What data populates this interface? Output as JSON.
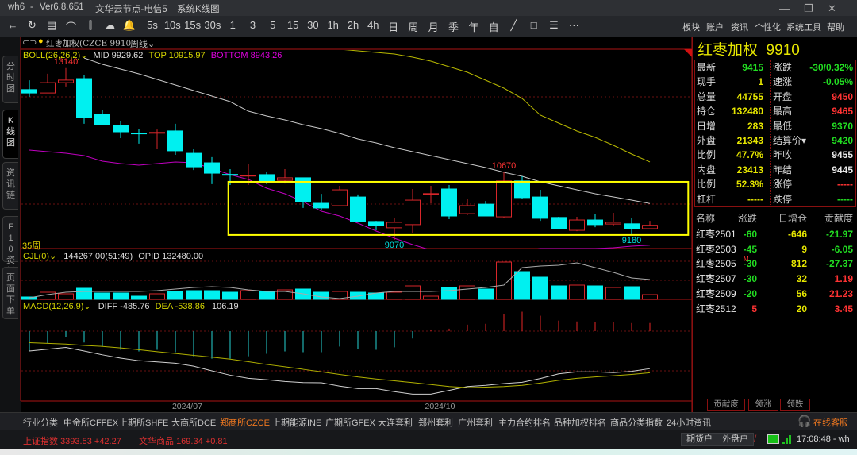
{
  "window": {
    "app": "wh6",
    "sep": "-",
    "version": "Ver6.8.651",
    "server": "文华云节点-电信5",
    "view": "系统K线图",
    "minimize": "—",
    "maximize": "❐",
    "close": "✕"
  },
  "toolbar": {
    "icons": [
      {
        "name": "back-arrow-icon",
        "glyph": "←"
      },
      {
        "name": "refresh-icon",
        "glyph": "↻"
      },
      {
        "name": "list-view-icon",
        "glyph": "▤"
      },
      {
        "name": "line-chart-icon",
        "glyph": "⌒"
      },
      {
        "name": "candlestick-icon",
        "glyph": "⫿"
      },
      {
        "name": "cloud-sync-icon",
        "glyph": "☁"
      },
      {
        "name": "bell-icon",
        "glyph": "🔔"
      }
    ],
    "periods": [
      "5s",
      "10s",
      "15s",
      "30s",
      "1",
      "3",
      "5",
      "15",
      "30",
      "1h",
      "2h",
      "4h",
      "日",
      "周",
      "月",
      "季",
      "年",
      "自"
    ],
    "tools": [
      {
        "name": "draw-line-icon",
        "glyph": "╱"
      },
      {
        "name": "rectangle-icon",
        "glyph": "□"
      },
      {
        "name": "layout-icon",
        "glyph": "☰"
      },
      {
        "name": "more-icon",
        "glyph": "···"
      }
    ],
    "menus": [
      "板块",
      "账户",
      "资讯",
      "个性化",
      "系统工具",
      "帮助"
    ]
  },
  "sidebar_tabs": [
    "分时图",
    "K线图",
    "资讯链",
    "F10资料",
    "页面下单"
  ],
  "chart_header": {
    "instrument": "红枣加权(CZCE 9910)",
    "period": "周线⌄"
  },
  "boll": {
    "label": "BOLL(26,26,2)⌄",
    "mid": "MID 9929.62",
    "top": "TOP 10915.97",
    "bottom": "BOTTOM 8943.26"
  },
  "bar_count_label": "35周",
  "volume_header": {
    "label": "CJL(0)⌄",
    "vol": "144267.00(51:49)",
    "opid": "OPID 132480.00"
  },
  "macd_header": {
    "label": "MACD(12,26,9)⌄",
    "diff": "DIFF -485.76",
    "dea": "DEA -538.86",
    "macd": "106.19"
  },
  "quote": {
    "title": "红枣加权  9910",
    "left": [
      {
        "label": "最新",
        "value": "9415",
        "color": "#22dd22"
      },
      {
        "label": "现手",
        "value": "1",
        "color": "#e6e600"
      },
      {
        "label": "总量",
        "value": "44755",
        "color": "#e6e600"
      },
      {
        "label": "持仓",
        "value": "132480",
        "color": "#e6e600"
      },
      {
        "label": "日增",
        "value": "283",
        "color": "#e6e600"
      },
      {
        "label": "外盘",
        "value": "21343",
        "color": "#e6e600"
      },
      {
        "label": "比例",
        "value": "47.7%",
        "color": "#e6e600"
      },
      {
        "label": "内盘",
        "value": "23413",
        "color": "#e6e600"
      },
      {
        "label": "比例",
        "value": "52.3%",
        "color": "#e6e600"
      },
      {
        "label": "杠杆",
        "value": "-----",
        "color": "#e6e600"
      }
    ],
    "right": [
      {
        "label": "涨跌",
        "value": "-30/0.32%",
        "color": "#22dd22"
      },
      {
        "label": "速涨",
        "value": "-0.05%",
        "color": "#22dd22"
      },
      {
        "label": "开盘",
        "value": "9450",
        "color": "#ff3333"
      },
      {
        "label": "最高",
        "value": "9465",
        "color": "#ff3333"
      },
      {
        "label": "最低",
        "value": "9370",
        "color": "#22dd22"
      },
      {
        "label": "结算价▾",
        "value": "9420",
        "color": "#22dd22"
      },
      {
        "label": "昨收",
        "value": "9455",
        "color": "#e8e8e8"
      },
      {
        "label": "昨结",
        "value": "9445",
        "color": "#e8e8e8"
      },
      {
        "label": "涨停",
        "value": "-----",
        "color": "#ff3333"
      },
      {
        "label": "跌停",
        "value": "-----",
        "color": "#22dd22"
      }
    ]
  },
  "contracts": {
    "headers": [
      "名称",
      "涨跌",
      "日增仓",
      "贡献度"
    ],
    "rows": [
      {
        "name": "红枣2501",
        "tag": "",
        "change": "-60",
        "change_color": "#22dd22",
        "oi": "-646",
        "contrib": "-21.97",
        "contrib_color": "#22dd22"
      },
      {
        "name": "红枣2503",
        "tag": "",
        "change": "-45",
        "change_color": "#22dd22",
        "oi": "9",
        "contrib": "-6.05",
        "contrib_color": "#22dd22"
      },
      {
        "name": "红枣2505",
        "tag": "M",
        "change": "-30",
        "change_color": "#22dd22",
        "oi": "812",
        "contrib": "-27.37",
        "contrib_color": "#22dd22"
      },
      {
        "name": "红枣2507",
        "tag": "",
        "change": "-30",
        "change_color": "#22dd22",
        "oi": "32",
        "contrib": "1.19",
        "contrib_color": "#ff3333"
      },
      {
        "name": "红枣2509",
        "tag": "",
        "change": "-20",
        "change_color": "#22dd22",
        "oi": "56",
        "contrib": "21.23",
        "contrib_color": "#ff3333"
      },
      {
        "name": "红枣2512",
        "tag": "",
        "change": "5",
        "change_color": "#ff3333",
        "oi": "20",
        "contrib": "3.45",
        "contrib_color": "#ff3333"
      }
    ],
    "tabs": [
      "贡献度",
      "领涨",
      "领跌"
    ]
  },
  "bottom_nav": {
    "items": [
      "行业分类",
      "中金所CFFEX",
      "上期所SHFE",
      "大商所DCE",
      "郑商所CZCE",
      "上期能源INE",
      "广期所GFEX",
      "大连套利",
      "郑州套利",
      "广州套利",
      "主力合约排名",
      "品种加权排名",
      "商品分类指数",
      "24小时资讯"
    ],
    "active": "郑商所CZCE",
    "support": "在线客服"
  },
  "status": {
    "index1": {
      "name": "上证指数",
      "value": "3393.53",
      "change": "+42.27"
    },
    "index2": {
      "name": "文华商品",
      "value": "169.34",
      "change": "+0.81"
    },
    "buttons": [
      "期货户",
      "外盘户"
    ],
    "time": "17:08:48 - wh"
  },
  "colors": {
    "up": "#d8262a",
    "down": "#00f0f0",
    "border": "#8a1010",
    "accent": "#f07820"
  },
  "chart_data": {
    "type": "candlestick",
    "title": "红枣加权(CZCE 9910) 周线",
    "x_ticks": [
      {
        "label": "2024/07",
        "index": 8.65
      },
      {
        "label": "2024/10",
        "index": 22.5
      }
    ],
    "ohlc": [
      [
        12630,
        12850,
        12460,
        12550
      ],
      [
        12550,
        13005,
        12550,
        12795
      ],
      [
        12795,
        13140,
        12705,
        12855
      ],
      [
        12890,
        12985,
        11820,
        11970
      ],
      [
        12045,
        12155,
        11800,
        11800
      ],
      [
        11780,
        11875,
        11480,
        11630
      ],
      [
        11600,
        11705,
        11350,
        11590
      ],
      [
        11605,
        11685,
        11215,
        11615
      ],
      [
        11650,
        11820,
        11085,
        11180
      ],
      [
        11120,
        11215,
        10725,
        10800
      ],
      [
        10895,
        11030,
        10390,
        10650
      ],
      [
        10620,
        10745,
        10370,
        10610
      ],
      [
        10590,
        10875,
        10370,
        10600
      ],
      [
        10615,
        10670,
        10390,
        10465
      ],
      [
        10480,
        10745,
        10405,
        10540
      ],
      [
        10540,
        10540,
        9825,
        9975
      ],
      [
        9935,
        10160,
        9785,
        9825
      ],
      [
        9880,
        10350,
        9860,
        10255
      ],
      [
        10085,
        10145,
        9485,
        9505
      ],
      [
        9505,
        9520,
        9295,
        9410
      ],
      [
        9355,
        9595,
        9070,
        9485
      ],
      [
        9430,
        10275,
        9220,
        10010
      ],
      [
        10160,
        10350,
        9935,
        10165
      ],
      [
        10275,
        10370,
        9560,
        9635
      ],
      [
        9690,
        10050,
        9655,
        9880
      ],
      [
        9915,
        9990,
        9635,
        9635
      ],
      [
        9615,
        10670,
        9580,
        10465
      ],
      [
        10465,
        10575,
        10030,
        10070
      ],
      [
        10085,
        10255,
        9520,
        9580
      ],
      [
        9600,
        9615,
        9335,
        9335
      ],
      [
        9295,
        9615,
        9275,
        9540
      ],
      [
        9540,
        9690,
        9370,
        9430
      ],
      [
        9445,
        9710,
        9410,
        9485
      ],
      [
        9450,
        9580,
        9180,
        9335
      ],
      [
        9335,
        9520,
        9315,
        9415
      ]
    ],
    "boll": [
      {
        "name": "MID",
        "color": "#c8c8c8",
        "start_index": 3,
        "values": [
          13380,
          13230,
          13117,
          13004,
          12872,
          12740,
          12608,
          12477,
          12345,
          12119,
          12006,
          11912,
          11799,
          11705,
          11592,
          11460,
          11366,
          11253,
          11159,
          11065,
          10971,
          10877,
          10783,
          10670,
          10576,
          10444,
          10350,
          10256,
          10162,
          10087,
          10011,
          9930
        ]
      },
      {
        "name": "TOP",
        "color": "#b8b800",
        "start_index": 17,
        "values": [
          13587,
          13549,
          13512,
          13474,
          13399,
          13305,
          13173,
          13041,
          12853,
          12665,
          12420,
          12025,
          11837,
          11649,
          11498,
          11310,
          11103,
          10916
        ]
      },
      {
        "name": "BOTTOM",
        "color": "#c000c0",
        "start_index": 0,
        "values": [
          11197,
          11159,
          11122,
          11065,
          10933,
          10877,
          10839,
          10877,
          10915,
          10896,
          10764,
          10614,
          10501,
          10294,
          10162,
          9974,
          9748,
          9635,
          9466,
          9277,
          9108,
          8957,
          8826,
          8732,
          8694,
          8713,
          8750,
          8807,
          8863,
          8863,
          8863,
          8863,
          8882,
          8920,
          8943
        ]
      }
    ],
    "price_labels": [
      {
        "text": "13140",
        "index": 2,
        "price": 13140,
        "pos": "above",
        "color": "#ff3333"
      },
      {
        "text": "10670",
        "index": 26,
        "price": 10670,
        "pos": "above",
        "color": "#ff3333"
      },
      {
        "text": "9070",
        "index": 20,
        "price": 9070,
        "pos": "below",
        "color": "#00e0e0"
      },
      {
        "text": "9180",
        "index": 33,
        "price": 9180,
        "pos": "below",
        "color": "#00e0e0"
      }
    ],
    "annotation_rect": {
      "price_top": 10445,
      "price_bottom": 9185,
      "from_index": 10.9,
      "to_index": 36.1,
      "color": "#ffff00"
    },
    "volume": [
      15900,
      47700,
      37100,
      74200,
      42400,
      42400,
      21200,
      37100,
      53000,
      58300,
      58300,
      47700,
      58300,
      53000,
      63600,
      68900,
      47700,
      53000,
      47700,
      42400,
      47700,
      90100,
      21200,
      79500,
      90100,
      68900,
      249100,
      185500,
      148400,
      90100,
      95400,
      90100,
      79500,
      84800,
      31800
    ],
    "opid": [
      10600,
      31800,
      47700,
      53000,
      53000,
      53000,
      53000,
      58300,
      68900,
      79500,
      84800,
      79500,
      63600,
      53000,
      53000,
      37100,
      15900,
      5300,
      21200,
      42400,
      53000,
      53000,
      53000,
      58300,
      68900,
      79500,
      95400,
      212000,
      222600,
      227900,
      243800,
      212000,
      180200,
      143100,
      132500
    ],
    "macd": {
      "hist": [
        -252,
        -158,
        -74,
        -147,
        -200,
        -242,
        -263,
        -242,
        -273,
        -326,
        -357,
        -357,
        -326,
        -294,
        -263,
        -273,
        -273,
        -200,
        -231,
        -242,
        -210,
        -95,
        21,
        32,
        84,
        95,
        221,
        252,
        200,
        137,
        126,
        116,
        116,
        105,
        106
      ],
      "diff": [
        -257,
        -234,
        -211,
        -257,
        -307,
        -350,
        -383,
        -399,
        -416,
        -455,
        -515,
        -571,
        -611,
        -630,
        -653,
        -667,
        -670,
        -713,
        -746,
        -746,
        -785,
        -818,
        -818,
        -769,
        -719,
        -703,
        -680,
        -663,
        -614,
        -554,
        -528,
        -528,
        -538,
        -521,
        -486
      ],
      "dea": [
        -149,
        -158,
        -168,
        -185,
        -198,
        -218,
        -241,
        -267,
        -290,
        -314,
        -337,
        -363,
        -396,
        -432,
        -462,
        -495,
        -528,
        -561,
        -594,
        -620,
        -644,
        -667,
        -693,
        -719,
        -733,
        -726,
        -719,
        -703,
        -673,
        -637,
        -611,
        -594,
        -578,
        -561,
        -539
      ]
    }
  }
}
